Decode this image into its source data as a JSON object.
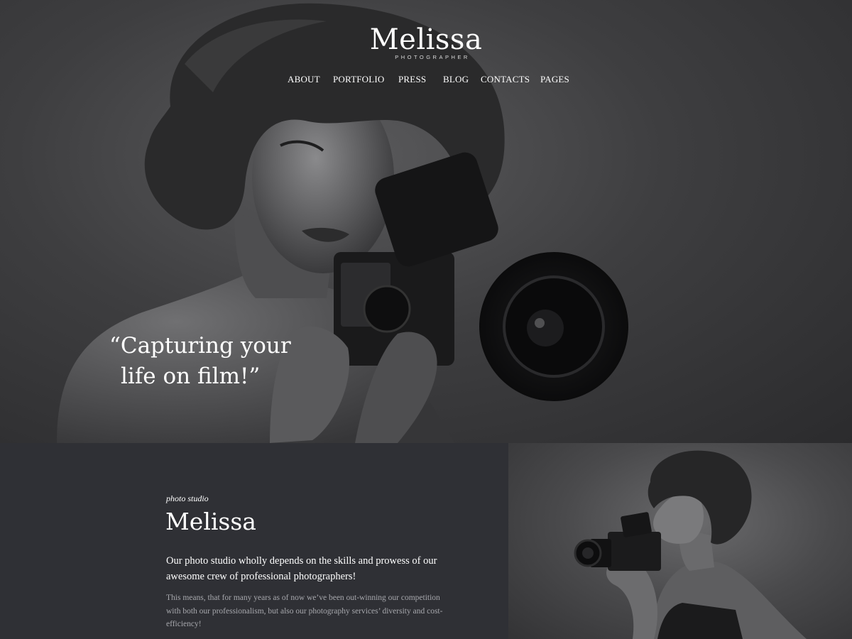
{
  "brand": {
    "name": "Melissa",
    "tagline": "PHOTOGRAPHER"
  },
  "nav": {
    "items": [
      {
        "label": "ABOUT"
      },
      {
        "label": "PORTFOLIO"
      },
      {
        "label": "PRESS"
      },
      {
        "label": "BLOG"
      },
      {
        "label": "CONTACTS"
      },
      {
        "label": "PAGES"
      }
    ]
  },
  "hero": {
    "quote_line1": "“Capturing your",
    "quote_line2": "life on film!”"
  },
  "about": {
    "kicker": "photo studio",
    "title": "Melissa",
    "lead": "Our photo studio wholly depends on the skills and prowess of our awesome crew of professional photographers!",
    "body": "This means, that for many years as of now we’ve been out-winning our competition with both our professionalism, but also our photography services’ diversity and cost-efficiency!"
  },
  "colors": {
    "about_bg": "#2f3035",
    "text_primary": "#ffffff",
    "text_muted": "#a7a8ad"
  }
}
